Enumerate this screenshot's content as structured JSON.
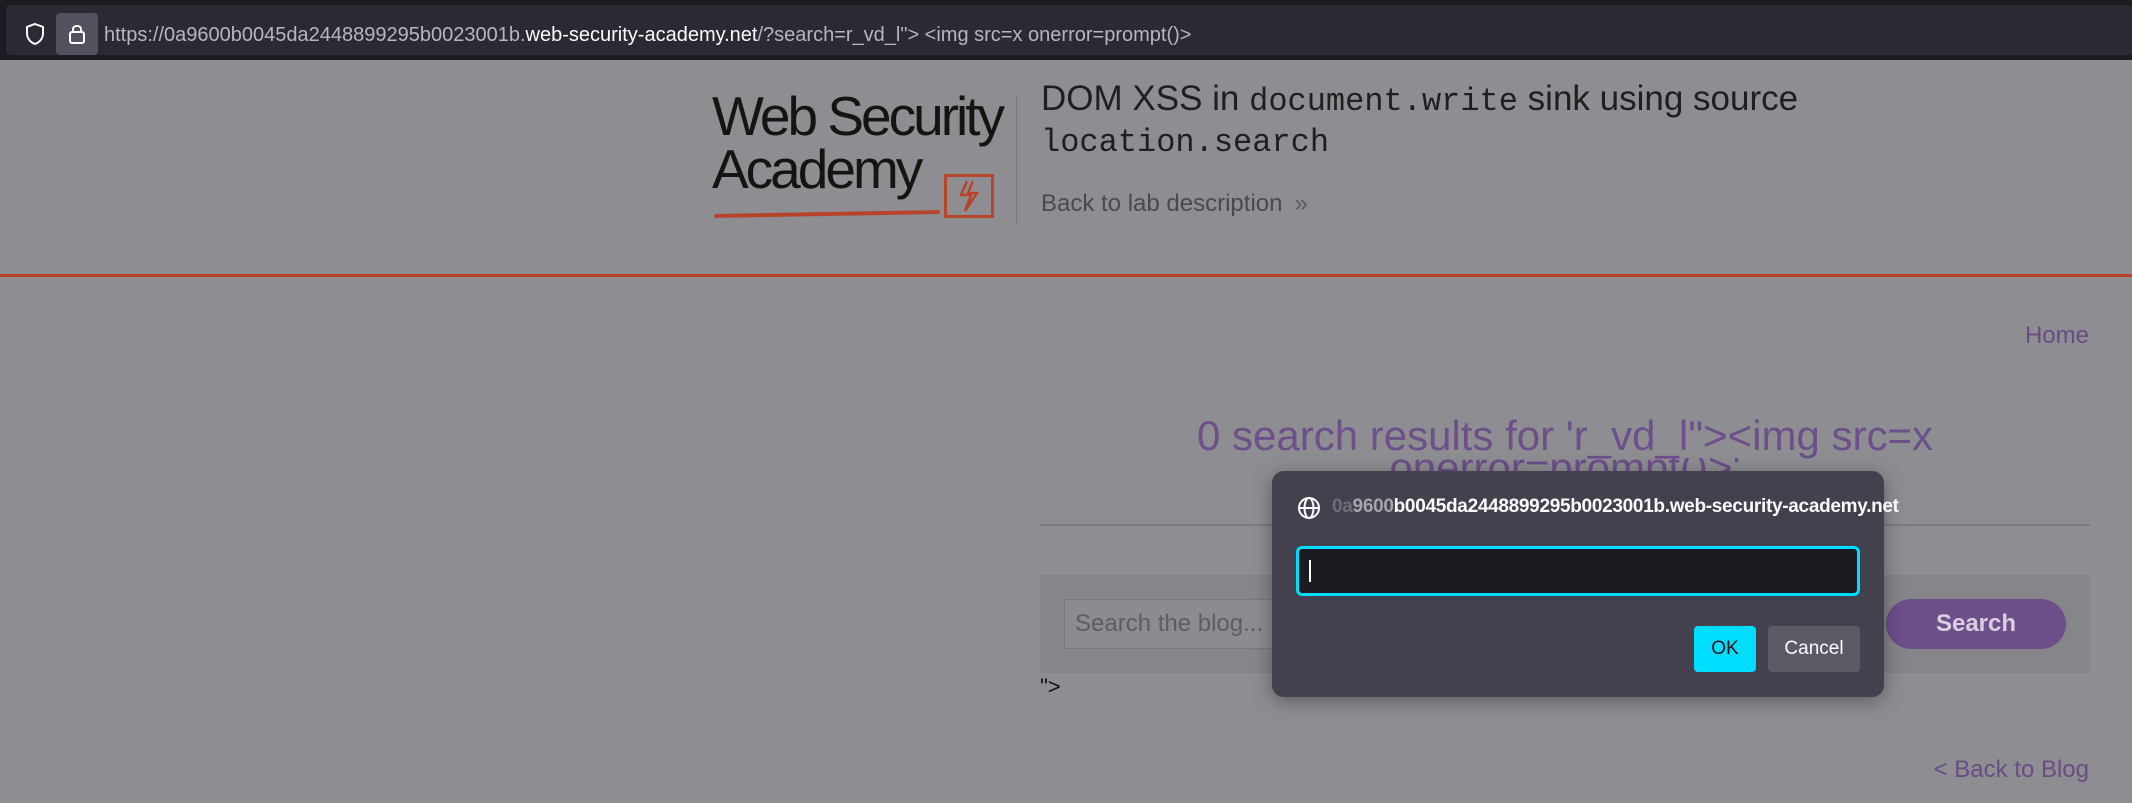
{
  "browser": {
    "url_prefix": "https://0a9600b0045da2448899295b0023001b.",
    "url_host": "web-security-academy.net",
    "url_suffix": "/?search=r_vd_l\"> <img src=x onerror=prompt()>"
  },
  "header": {
    "logo_line1": "Web Security",
    "logo_line2": "Academy",
    "title_pre": "DOM XSS in ",
    "title_code1": "document.write",
    "title_mid": " sink using source",
    "title_code2": "location.search",
    "back_label": "Back to lab description",
    "back_chevron": "»"
  },
  "nav": {
    "home": "Home"
  },
  "main": {
    "results_text": "0 search results for 'r_vd_l\"><img src=x",
    "results_overflow": "onerror=prompt()>'",
    "search_placeholder": "Search the blog...",
    "search_button": "Search",
    "stray_text": "\">",
    "back_blog": "< Back to Blog"
  },
  "dialog": {
    "origin_fade1": "0a",
    "origin_fade2": "9600",
    "origin_rest": "b0045da2448899295b0023001b.web-security-academy.net",
    "input_value": "",
    "ok_label": "OK",
    "cancel_label": "Cancel"
  },
  "colors": {
    "accent_orange": "#b7432a",
    "link_purple": "#6a4c84",
    "focus_cyan": "#00ddff"
  }
}
